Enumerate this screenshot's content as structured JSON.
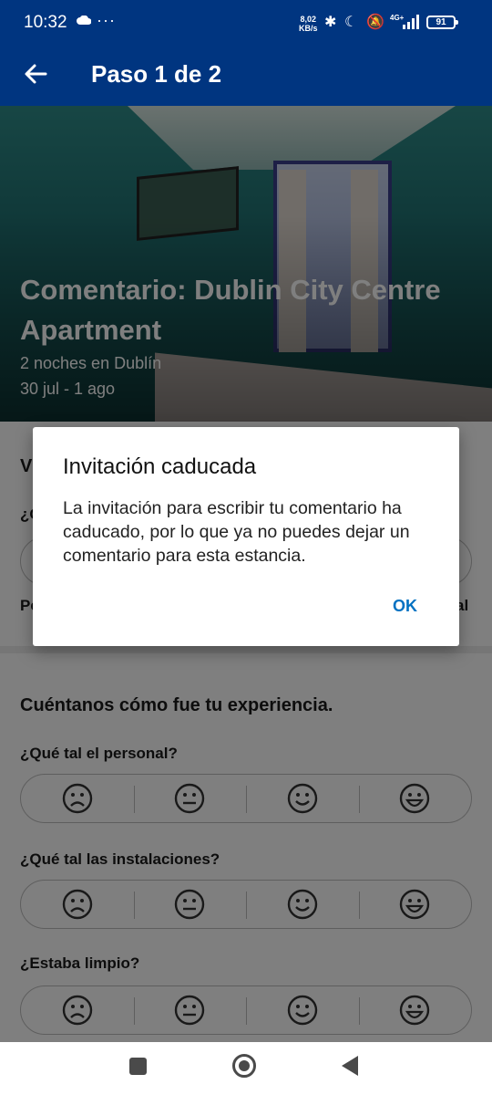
{
  "status_bar": {
    "time": "10:32",
    "more": "···",
    "speed": "8,02\nKB/s",
    "network": "4G+",
    "battery": "91"
  },
  "app_bar": {
    "title": "Paso 1 de 2"
  },
  "hero": {
    "title": "Comentario: Dublin City Centre Apartment",
    "nights": "2 noches en Dublín",
    "dates": "30 jul - 1 ago"
  },
  "partial_section": {
    "title_fragment": "V",
    "question_fragment": "¿C",
    "left_label_fragment": "Pe",
    "right_label_fragment": "al"
  },
  "experience": {
    "heading": "Cuéntanos cómo fue tu experiencia.",
    "questions": [
      "¿Qué tal el personal?",
      "¿Qué tal las instalaciones?",
      "¿Estaba limpio?"
    ],
    "faces": [
      "sad-face-icon",
      "neutral-face-icon",
      "happy-face-icon",
      "grin-face-icon"
    ]
  },
  "dialog": {
    "title": "Invitación caducada",
    "message": "La invitación para escribir tu comentario ha caducado, por lo que ya no puedes dejar un comentario para esta estancia.",
    "ok_label": "OK"
  },
  "colors": {
    "brand": "#003580",
    "accent": "#0071c2"
  }
}
